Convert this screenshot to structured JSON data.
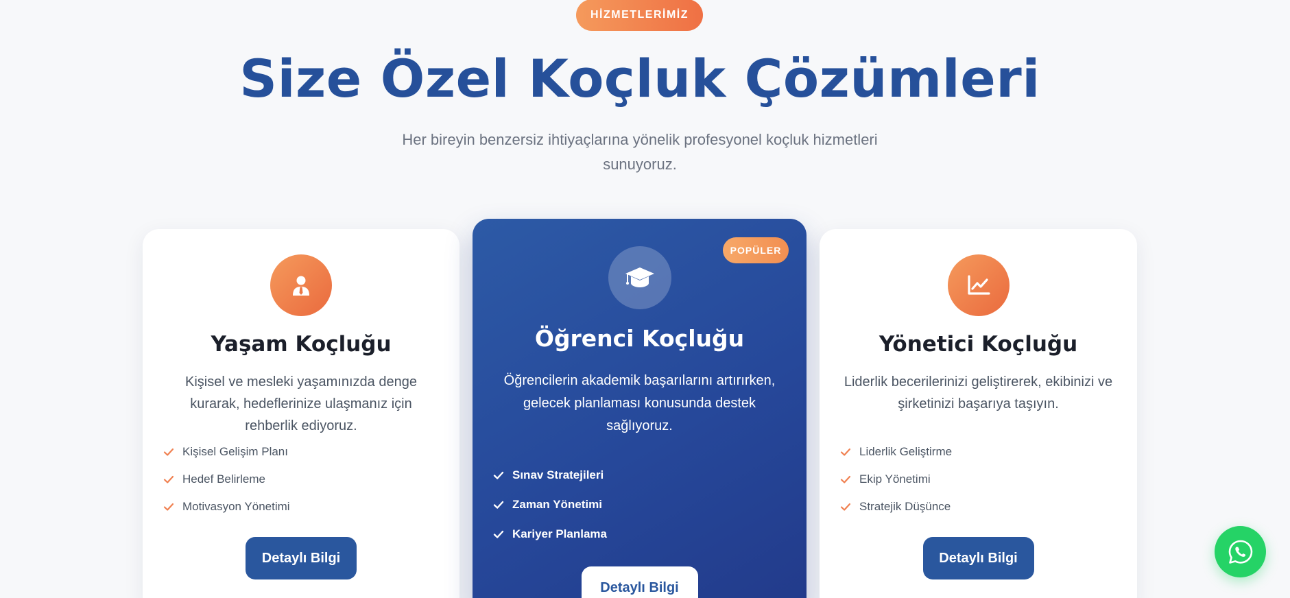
{
  "section": {
    "eyebrow": "HİZMETLERİMİZ",
    "title": "Size Özel Koçluk Çözümleri",
    "subtitle": "Her bireyin benzersiz ihtiyaçlarına yönelik profesyonel koçluk hizmetleri sunuyoruz."
  },
  "cards": [
    {
      "icon": "person-tie-icon",
      "title": "Yaşam Koçluğu",
      "description": "Kişisel ve mesleki yaşamınızda denge kurarak, hedeflerinize ulaşmanız için rehberlik ediyoruz.",
      "features": [
        "Kişisel Gelişim Planı",
        "Hedef Belirleme",
        "Motivasyon Yönetimi"
      ],
      "button": "Detaylı Bilgi"
    },
    {
      "icon": "graduation-cap-icon",
      "badge": "POPÜLER",
      "title": "Öğrenci Koçluğu",
      "description": "Öğrencilerin akademik başarılarını artırırken, gelecek planlaması konusunda destek sağlıyoruz.",
      "features": [
        "Sınav Stratejileri",
        "Zaman Yönetimi",
        "Kariyer Planlama"
      ],
      "button": "Detaylı Bilgi"
    },
    {
      "icon": "line-chart-icon",
      "title": "Yönetici Koçluğu",
      "description": "Liderlik becerilerinizi geliştirerek, ekibinizi ve şirketinizi başarıya taşıyın.",
      "features": [
        "Liderlik Geliştirme",
        "Ekip Yönetimi",
        "Stratejik Düşünce"
      ],
      "button": "Detaylı Bilgi"
    }
  ],
  "floating": {
    "whatsapp_icon": "whatsapp-icon"
  },
  "colors": {
    "primary": "#2a579e",
    "accent": "#f08050",
    "whatsapp": "#25d366"
  }
}
